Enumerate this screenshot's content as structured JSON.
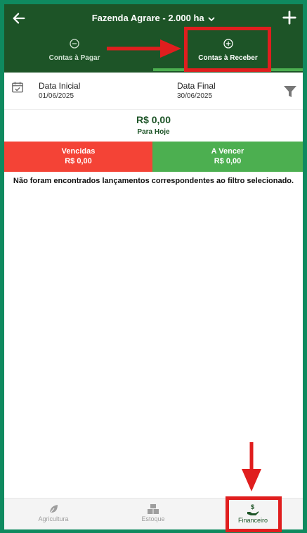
{
  "header": {
    "title": "Fazenda Agrare - 2.000 ha",
    "tabs": [
      {
        "label": "Contas à Pagar",
        "icon": "minus-circle-icon"
      },
      {
        "label": "Contas à Receber",
        "icon": "plus-circle-icon"
      }
    ]
  },
  "filters": {
    "start_label": "Data Inicial",
    "start_value": "01/06/2025",
    "end_label": "Data Final",
    "end_value": "30/06/2025"
  },
  "summary": {
    "amount": "R$ 0,00",
    "caption": "Para Hoje"
  },
  "cards": {
    "overdue": {
      "label": "Vencidas",
      "amount": "R$ 0,00"
    },
    "upcoming": {
      "label": "A Vencer",
      "amount": "R$ 0,00"
    }
  },
  "empty_message": "Não foram encontrados lançamentos correspondentes ao filtro selecionado.",
  "bottom_nav": [
    {
      "label": "Agricultura",
      "icon": "leaf-icon"
    },
    {
      "label": "Estoque",
      "icon": "boxes-icon"
    },
    {
      "label": "Financeiro",
      "icon": "money-hand-icon"
    }
  ],
  "colors": {
    "primary": "#1d5427",
    "accent": "#4caf50",
    "danger": "#f44336",
    "frame": "#0f8a5f",
    "annotation": "#e01e1e"
  }
}
